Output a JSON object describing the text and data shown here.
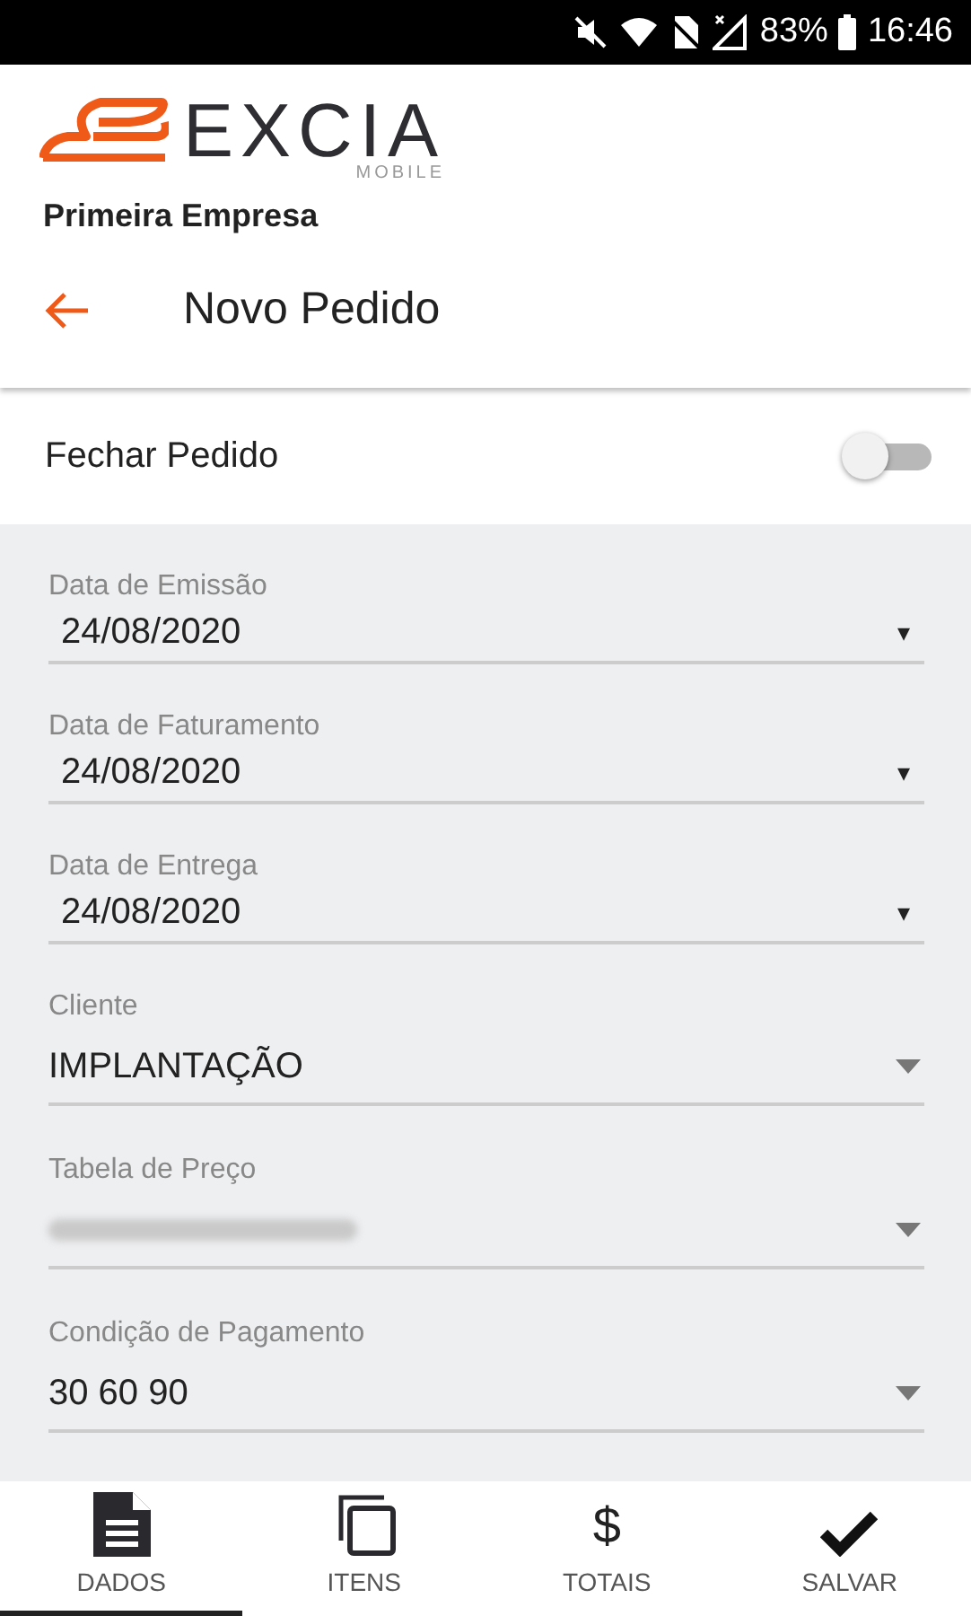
{
  "status_bar": {
    "battery": "83%",
    "time": "16:46"
  },
  "header": {
    "logo_word": "EXCIA",
    "logo_sub": "MOBILE",
    "company": "Primeira Empresa",
    "title": "Novo Pedido"
  },
  "close_order": {
    "label": "Fechar Pedido",
    "on": false
  },
  "fields": [
    {
      "kind": "date",
      "label": "Data de Emissão",
      "value": "24/08/2020",
      "arrow": "▾"
    },
    {
      "kind": "date",
      "label": "Data de Faturamento",
      "value": "24/08/2020",
      "arrow": "▾"
    },
    {
      "kind": "date",
      "label": "Data de Entrega",
      "value": "24/08/2020",
      "arrow": "▾"
    },
    {
      "kind": "select",
      "label": "Cliente",
      "value": "IMPLANTAÇÃO"
    },
    {
      "kind": "select",
      "label": "Tabela de Preço",
      "redacted": true
    },
    {
      "kind": "select",
      "label": "Condição de Pagamento",
      "value": "30 60 90"
    }
  ],
  "bottom_nav": [
    {
      "kind": "document",
      "label": "DADOS",
      "selected": true
    },
    {
      "kind": "copy",
      "label": "ITENS",
      "selected": false
    },
    {
      "kind": "dollar",
      "glyph": "$",
      "label": "TOTAIS",
      "selected": false
    },
    {
      "kind": "check",
      "label": "SALVAR",
      "selected": false
    }
  ]
}
